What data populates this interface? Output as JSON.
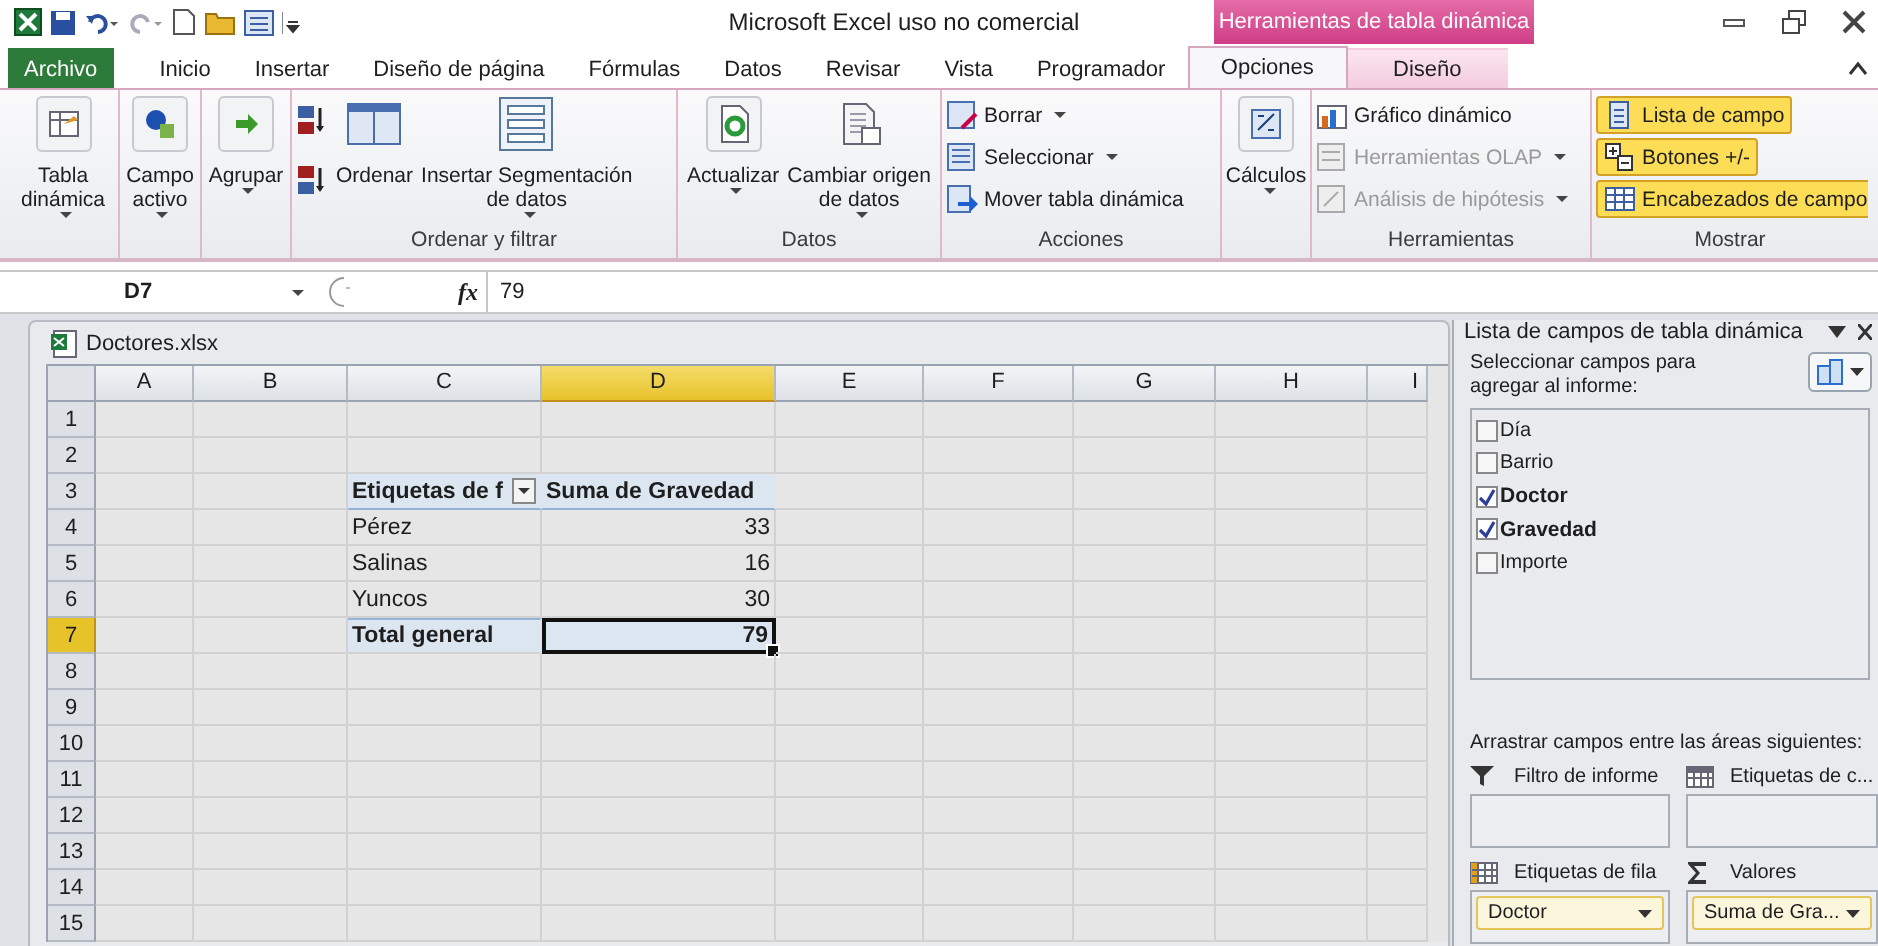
{
  "title_bar": {
    "title": "Microsoft Excel uso no comercial",
    "context_group": "Herramientas de tabla dinámica"
  },
  "tabs": [
    {
      "label": "Archivo",
      "kind": "file",
      "selected": false
    },
    {
      "label": "Inicio",
      "kind": "normal",
      "selected": false
    },
    {
      "label": "Insertar",
      "kind": "normal",
      "selected": false
    },
    {
      "label": "Diseño de página",
      "kind": "normal",
      "selected": false
    },
    {
      "label": "Fórmulas",
      "kind": "normal",
      "selected": false
    },
    {
      "label": "Datos",
      "kind": "normal",
      "selected": false
    },
    {
      "label": "Revisar",
      "kind": "normal",
      "selected": false
    },
    {
      "label": "Vista",
      "kind": "normal",
      "selected": false
    },
    {
      "label": "Programador",
      "kind": "normal",
      "selected": false
    },
    {
      "label": "Opciones",
      "kind": "context",
      "selected": true
    },
    {
      "label": "Diseño",
      "kind": "context",
      "selected": false
    }
  ],
  "ribbon": {
    "groups": [
      {
        "buttons": [
          {
            "kind": "large",
            "label": "Tabla\ndinámica",
            "dropdown": true
          }
        ]
      },
      {
        "buttons": [
          {
            "kind": "large",
            "label": "Campo\nactivo",
            "dropdown": true
          }
        ]
      },
      {
        "buttons": [
          {
            "kind": "large",
            "label": "Agrupar",
            "dropdown": true
          }
        ]
      },
      {
        "label": "Ordenar y filtrar",
        "buttons": [
          {
            "kind": "sortpair"
          },
          {
            "kind": "large",
            "label": "Ordenar",
            "dropdown": false
          },
          {
            "kind": "large",
            "label": "Insertar Segmentación\nde datos",
            "dropdown": true
          }
        ]
      },
      {
        "label": "Datos",
        "buttons": [
          {
            "kind": "large",
            "label": "Actualizar",
            "dropdown": true
          },
          {
            "kind": "large",
            "label": "Cambiar origen\nde datos",
            "dropdown": true
          }
        ]
      },
      {
        "label": "Acciones",
        "buttons": [
          {
            "kind": "small",
            "label": "Borrar",
            "dropdown": true,
            "disabled": false
          },
          {
            "kind": "small",
            "label": "Seleccionar",
            "dropdown": true,
            "disabled": false
          },
          {
            "kind": "small",
            "label": "Mover tabla dinámica",
            "dropdown": false,
            "disabled": false
          }
        ]
      },
      {
        "buttons": [
          {
            "kind": "large",
            "label": "Cálculos",
            "dropdown": true
          }
        ]
      },
      {
        "label": "Herramientas",
        "buttons": [
          {
            "kind": "small",
            "label": "Gráfico dinámico",
            "dropdown": false,
            "disabled": false
          },
          {
            "kind": "small",
            "label": "Herramientas OLAP",
            "dropdown": true,
            "disabled": true
          },
          {
            "kind": "small",
            "label": "Análisis de hipótesis",
            "dropdown": true,
            "disabled": true
          }
        ]
      },
      {
        "label": "Mostrar",
        "buttons": [
          {
            "kind": "toggle",
            "label": "Lista de campo",
            "on": true
          },
          {
            "kind": "toggle",
            "label": "Botones +/-",
            "on": true
          },
          {
            "kind": "toggle",
            "label": "Encabezados de campo",
            "on": true
          }
        ]
      }
    ]
  },
  "formula_bar": {
    "name_box": "D7",
    "function_label": "fx",
    "formula": "79"
  },
  "workbook": {
    "title": "Doctores.xlsx",
    "columns": [
      {
        "letter": "A",
        "selected": false
      },
      {
        "letter": "B",
        "selected": false
      },
      {
        "letter": "C",
        "selected": false
      },
      {
        "letter": "D",
        "selected": true
      },
      {
        "letter": "E",
        "selected": false
      },
      {
        "letter": "F",
        "selected": false
      },
      {
        "letter": "G",
        "selected": false
      },
      {
        "letter": "H",
        "selected": false
      },
      {
        "letter": "I",
        "selected": false
      }
    ],
    "rows": [
      {
        "number": "1",
        "selected": false
      },
      {
        "number": "2",
        "selected": false
      },
      {
        "number": "3",
        "selected": false
      },
      {
        "number": "4",
        "selected": false
      },
      {
        "number": "5",
        "selected": false
      },
      {
        "number": "6",
        "selected": false
      },
      {
        "number": "7",
        "selected": true
      },
      {
        "number": "8",
        "selected": false
      },
      {
        "number": "9",
        "selected": false
      },
      {
        "number": "10",
        "selected": false
      },
      {
        "number": "11",
        "selected": false
      },
      {
        "number": "12",
        "selected": false
      },
      {
        "number": "13",
        "selected": false
      },
      {
        "number": "14",
        "selected": false
      },
      {
        "number": "15",
        "selected": false
      }
    ],
    "pivot": {
      "header": {
        "row_label": "Etiquetas de f",
        "value_label": "Suma de Gravedad"
      },
      "rows": [
        {
          "label": "Pérez",
          "value": "33"
        },
        {
          "label": "Salinas",
          "value": "16"
        },
        {
          "label": "Yuncos",
          "value": "30"
        }
      ],
      "total": {
        "label": "Total general",
        "value": "79",
        "selected": true
      }
    }
  },
  "field_list": {
    "title": "Lista de campos de tabla dinámica",
    "prompt": "Seleccionar campos para agregar al informe:",
    "fields": [
      {
        "label": "Día",
        "checked": false
      },
      {
        "label": "Barrio",
        "checked": false
      },
      {
        "label": "Doctor",
        "checked": true
      },
      {
        "label": "Gravedad",
        "checked": true
      },
      {
        "label": "Importe",
        "checked": false
      }
    ],
    "areas_prompt": "Arrastrar campos entre las áreas siguientes:",
    "areas": [
      {
        "kind": "filter",
        "label": "Filtro de informe"
      },
      {
        "kind": "columns",
        "label": "Etiquetas de c..."
      },
      {
        "kind": "rows",
        "label": "Etiquetas de fila",
        "items": [
          "Doctor"
        ]
      },
      {
        "kind": "values",
        "label": "Valores",
        "items": [
          "Suma de Gra..."
        ]
      }
    ]
  }
}
